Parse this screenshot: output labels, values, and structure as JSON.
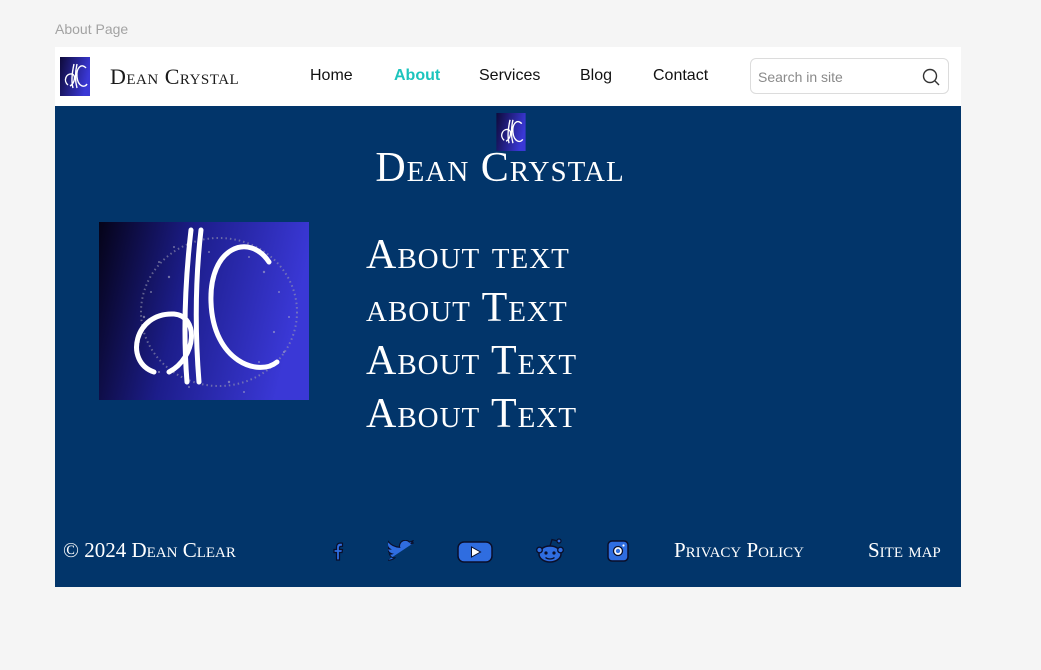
{
  "frame_label": "About Page",
  "header": {
    "brand": "Dean Crystal",
    "logo_icon": "dc-monogram-logo",
    "nav": [
      {
        "label": "Home",
        "active": false
      },
      {
        "label": "About",
        "active": true
      },
      {
        "label": "Services",
        "active": false
      },
      {
        "label": "Blog",
        "active": false
      },
      {
        "label": "Contact",
        "active": false
      }
    ],
    "search": {
      "placeholder": "Search in site",
      "value": "",
      "icon": "search-icon"
    }
  },
  "hero": {
    "title": "Dean Crystal",
    "logo_icon": "dc-monogram-logo"
  },
  "about": {
    "image_icon": "dc-monogram-artwork",
    "lines": [
      "About text",
      "about Text",
      "About Text",
      "About Text"
    ]
  },
  "footer": {
    "copyright": "© 2024 Dean Clear",
    "social_icons": [
      "facebook-icon",
      "twitter-icon",
      "youtube-icon",
      "reddit-icon",
      "instagram-icon"
    ],
    "links": [
      "Privacy Policy",
      "Site map"
    ]
  },
  "colors": {
    "page_bg": "#f5f5f5",
    "main_bg": "#02356a",
    "nav_bg": "#ffffff",
    "accent": "#1cc4bd",
    "logo_dark": "#0e0a3a",
    "logo_light": "#3a38d6",
    "social_blue": "#2f6de0"
  }
}
